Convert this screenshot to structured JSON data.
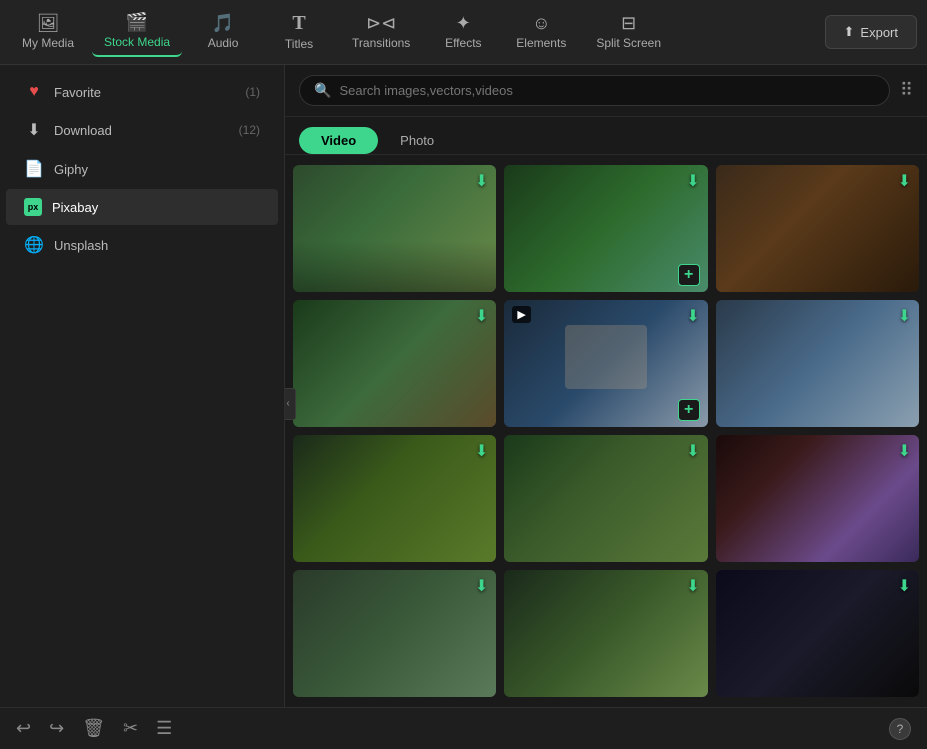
{
  "topNav": {
    "items": [
      {
        "id": "my-media",
        "label": "My Media",
        "icon": "🖼"
      },
      {
        "id": "stock-media",
        "label": "Stock Media",
        "icon": "🎬",
        "active": true
      },
      {
        "id": "audio",
        "label": "Audio",
        "icon": "🎵"
      },
      {
        "id": "titles",
        "label": "Titles",
        "icon": "T"
      },
      {
        "id": "transitions",
        "label": "Transitions",
        "icon": "⊳⊲"
      },
      {
        "id": "effects",
        "label": "Effects",
        "icon": "✦"
      },
      {
        "id": "elements",
        "label": "Elements",
        "icon": "☺"
      },
      {
        "id": "split-screen",
        "label": "Split Screen",
        "icon": "⊟"
      }
    ],
    "exportLabel": "Export"
  },
  "sidebar": {
    "items": [
      {
        "id": "favorite",
        "label": "Favorite",
        "icon": "♥",
        "count": "(1)"
      },
      {
        "id": "download",
        "label": "Download",
        "icon": "⬇",
        "count": "(12)"
      },
      {
        "id": "giphy",
        "label": "Giphy",
        "icon": "📄",
        "count": ""
      },
      {
        "id": "pixabay",
        "label": "Pixabay",
        "icon": "px",
        "count": "",
        "active": true
      },
      {
        "id": "unsplash",
        "label": "Unsplash",
        "icon": "🌐",
        "count": ""
      }
    ]
  },
  "search": {
    "placeholder": "Search images,vectors,videos",
    "value": ""
  },
  "contentTabs": [
    {
      "id": "video",
      "label": "Video",
      "active": true
    },
    {
      "id": "photo",
      "label": "Photo"
    }
  ],
  "mediaGrid": {
    "items": [
      {
        "id": 1,
        "thumb": "thumb-1",
        "hasDownload": true,
        "hasAdd": false,
        "hasVideoIcon": false
      },
      {
        "id": 2,
        "thumb": "thumb-2",
        "hasDownload": true,
        "hasAdd": true,
        "hasVideoIcon": false
      },
      {
        "id": 3,
        "thumb": "thumb-3",
        "hasDownload": true,
        "hasAdd": false,
        "hasVideoIcon": false
      },
      {
        "id": 4,
        "thumb": "thumb-4",
        "hasDownload": true,
        "hasAdd": false,
        "hasVideoIcon": false
      },
      {
        "id": 5,
        "thumb": "thumb-5",
        "hasDownload": true,
        "hasAdd": true,
        "hasVideoIcon": true
      },
      {
        "id": 6,
        "thumb": "thumb-6",
        "hasDownload": true,
        "hasAdd": false,
        "hasVideoIcon": false
      },
      {
        "id": 7,
        "thumb": "thumb-7",
        "hasDownload": true,
        "hasAdd": false,
        "hasVideoIcon": false
      },
      {
        "id": 8,
        "thumb": "thumb-8",
        "hasDownload": true,
        "hasAdd": false,
        "hasVideoIcon": false
      },
      {
        "id": 9,
        "thumb": "thumb-9",
        "hasDownload": true,
        "hasAdd": false,
        "hasVideoIcon": false
      },
      {
        "id": 10,
        "thumb": "thumb-10",
        "hasDownload": true,
        "hasAdd": false,
        "hasVideoIcon": false
      },
      {
        "id": 11,
        "thumb": "thumb-11",
        "hasDownload": true,
        "hasAdd": false,
        "hasVideoIcon": false
      },
      {
        "id": 12,
        "thumb": "thumb-12",
        "hasDownload": true,
        "hasAdd": false,
        "hasVideoIcon": false
      }
    ]
  },
  "bottomToolbar": {
    "icons": [
      {
        "id": "undo",
        "symbol": "↩",
        "label": "Undo"
      },
      {
        "id": "redo",
        "symbol": "↪",
        "label": "Redo"
      },
      {
        "id": "delete",
        "symbol": "🗑",
        "label": "Delete"
      },
      {
        "id": "cut",
        "symbol": "✂",
        "label": "Cut"
      },
      {
        "id": "menu",
        "symbol": "☰",
        "label": "Menu"
      }
    ],
    "helpLabel": "?"
  }
}
